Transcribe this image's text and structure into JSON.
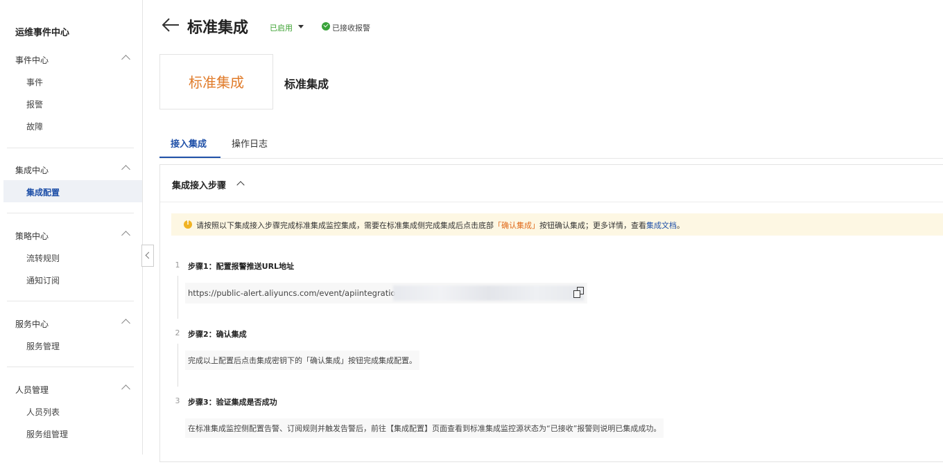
{
  "sidebar": {
    "title": "运维事件中心",
    "groups": [
      {
        "label": "事件中心",
        "items": [
          {
            "label": "事件"
          },
          {
            "label": "报警"
          },
          {
            "label": "故障"
          }
        ]
      },
      {
        "label": "集成中心",
        "items": [
          {
            "label": "集成配置",
            "active": true
          }
        ]
      },
      {
        "label": "策略中心",
        "items": [
          {
            "label": "流转规则"
          },
          {
            "label": "通知订阅"
          }
        ]
      },
      {
        "label": "服务中心",
        "items": [
          {
            "label": "服务管理"
          }
        ]
      },
      {
        "label": "人员管理",
        "items": [
          {
            "label": "人员列表"
          },
          {
            "label": "服务组管理"
          }
        ]
      }
    ]
  },
  "header": {
    "title": "标准集成",
    "status": "已启用",
    "received": "已接收报警"
  },
  "integration": {
    "logo_text": "标准集成",
    "name": "标准集成"
  },
  "tabs": [
    {
      "label": "接入集成",
      "active": true
    },
    {
      "label": "操作日志",
      "active": false
    }
  ],
  "panel": {
    "title": "集成接入步骤",
    "notice": {
      "text_before": "请按照以下集成接入步骤完成标准集成监控集成，需要在标准集成侧完成集成后点击底部",
      "highlight": "「确认集成」",
      "text_middle": "按钮确认集成；更多详情，查看",
      "link": "集成文档",
      "text_after": "。"
    },
    "steps": [
      {
        "num": "1",
        "title": "步骤1：配置报警推送URL地址",
        "body": "https://public-alert.aliyuncs.com/event/apiintegration/"
      },
      {
        "num": "2",
        "title": "步骤2：确认集成",
        "body": "完成以上配置后点击集成密钥下的「确认集成」按钮完成集成配置。"
      },
      {
        "num": "3",
        "title": "步骤3：验证集成是否成功",
        "body": "在标准集成监控侧配置告警、订阅规则并触发告警后，前往【集成配置】页面查看到标准集成监控源状态为“已接收”报警则说明已集成成功。"
      }
    ]
  },
  "colors": {
    "accent": "#1f50a8",
    "status_green": "#3aa12f",
    "logo_orange": "#e07b2a",
    "notice_bg": "#fdf7e3",
    "notice_highlight": "#e06a1a"
  }
}
